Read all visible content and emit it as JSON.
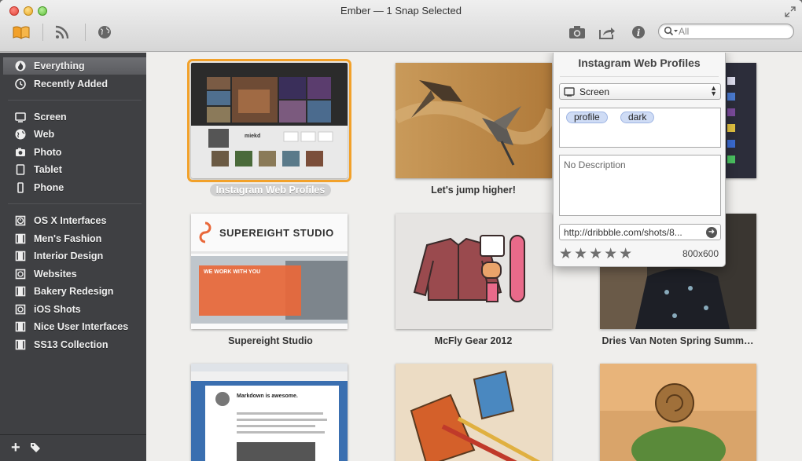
{
  "window": {
    "title": "Ember — 1 Snap Selected"
  },
  "toolbar": {
    "left_icons": [
      "library-icon",
      "rss-icon",
      "globe-icon"
    ],
    "right_icons": [
      "camera-icon",
      "share-icon",
      "info-icon"
    ],
    "search_placeholder": "All"
  },
  "sidebar": {
    "group1": [
      {
        "label": "Everything",
        "icon": "flame-icon",
        "selected": true
      },
      {
        "label": "Recently Added",
        "icon": "clock-icon",
        "selected": false
      }
    ],
    "group2": [
      {
        "label": "Screen",
        "icon": "screen-icon"
      },
      {
        "label": "Web",
        "icon": "web-icon"
      },
      {
        "label": "Photo",
        "icon": "photo-icon"
      },
      {
        "label": "Tablet",
        "icon": "tablet-icon"
      },
      {
        "label": "Phone",
        "icon": "phone-icon"
      }
    ],
    "group3": [
      {
        "label": "OS X Interfaces",
        "icon": "smart-collection-icon"
      },
      {
        "label": "Men's Fashion",
        "icon": "collection-icon"
      },
      {
        "label": "Interior Design",
        "icon": "collection-icon"
      },
      {
        "label": "Websites",
        "icon": "smart-collection-icon"
      },
      {
        "label": "Bakery Redesign",
        "icon": "collection-icon"
      },
      {
        "label": "iOS Shots",
        "icon": "smart-collection-icon"
      },
      {
        "label": "Nice User Interfaces",
        "icon": "collection-icon"
      },
      {
        "label": "SS13 Collection",
        "icon": "collection-icon"
      }
    ]
  },
  "grid": {
    "items": [
      {
        "caption": "Instagram Web Profiles",
        "selected": true
      },
      {
        "caption": "Let's jump higher!",
        "selected": false
      },
      {
        "caption": "",
        "selected": false
      },
      {
        "caption": "Supereight Studio",
        "selected": false
      },
      {
        "caption": "McFly Gear 2012",
        "selected": false
      },
      {
        "caption": "Dries Van Noten Spring Summ…",
        "selected": false
      },
      {
        "caption": "",
        "selected": false
      },
      {
        "caption": "",
        "selected": false
      },
      {
        "caption": "",
        "selected": false
      }
    ],
    "thumb_text": {
      "instagram_user": "miekd",
      "supereight_title": "SUPEREIGHT STUDIO",
      "supereight_banner": "WE WORK WITH YOU",
      "markdown_heading": "Markdown is awesome."
    }
  },
  "popover": {
    "title": "Instagram Web Profiles",
    "type": "Screen",
    "tags": [
      "profile",
      "dark"
    ],
    "description_placeholder": "No Description",
    "url": "http://dribbble.com/shots/8...",
    "rating": 5,
    "stars": "★★★★★",
    "dimensions": "800x600"
  }
}
